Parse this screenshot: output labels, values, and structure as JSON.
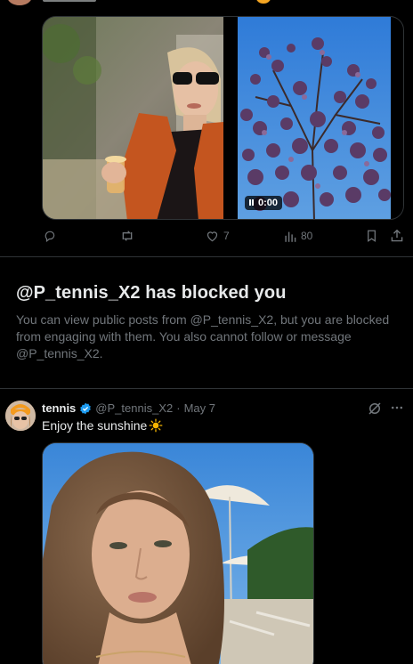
{
  "post1": {
    "video_time": "0:00",
    "stats": {
      "likes": "7",
      "views": "80"
    }
  },
  "blocked": {
    "title": "@P_tennis_X2 has blocked you",
    "body": "You can view public posts from @P_tennis_X2, but you are blocked from engaging with them. You also cannot follow or message @P_tennis_X2."
  },
  "post2": {
    "name": "tennis",
    "handle": "@P_tennis_X2",
    "separator": "·",
    "date": "May 7",
    "text": "Enjoy the sunshine",
    "emoji": "sun-icon",
    "verified_color": "#1d9bf0"
  },
  "colors": {
    "background": "#000000",
    "text_primary": "#e7e9ea",
    "text_secondary": "#71767b",
    "border": "#2f3336"
  }
}
